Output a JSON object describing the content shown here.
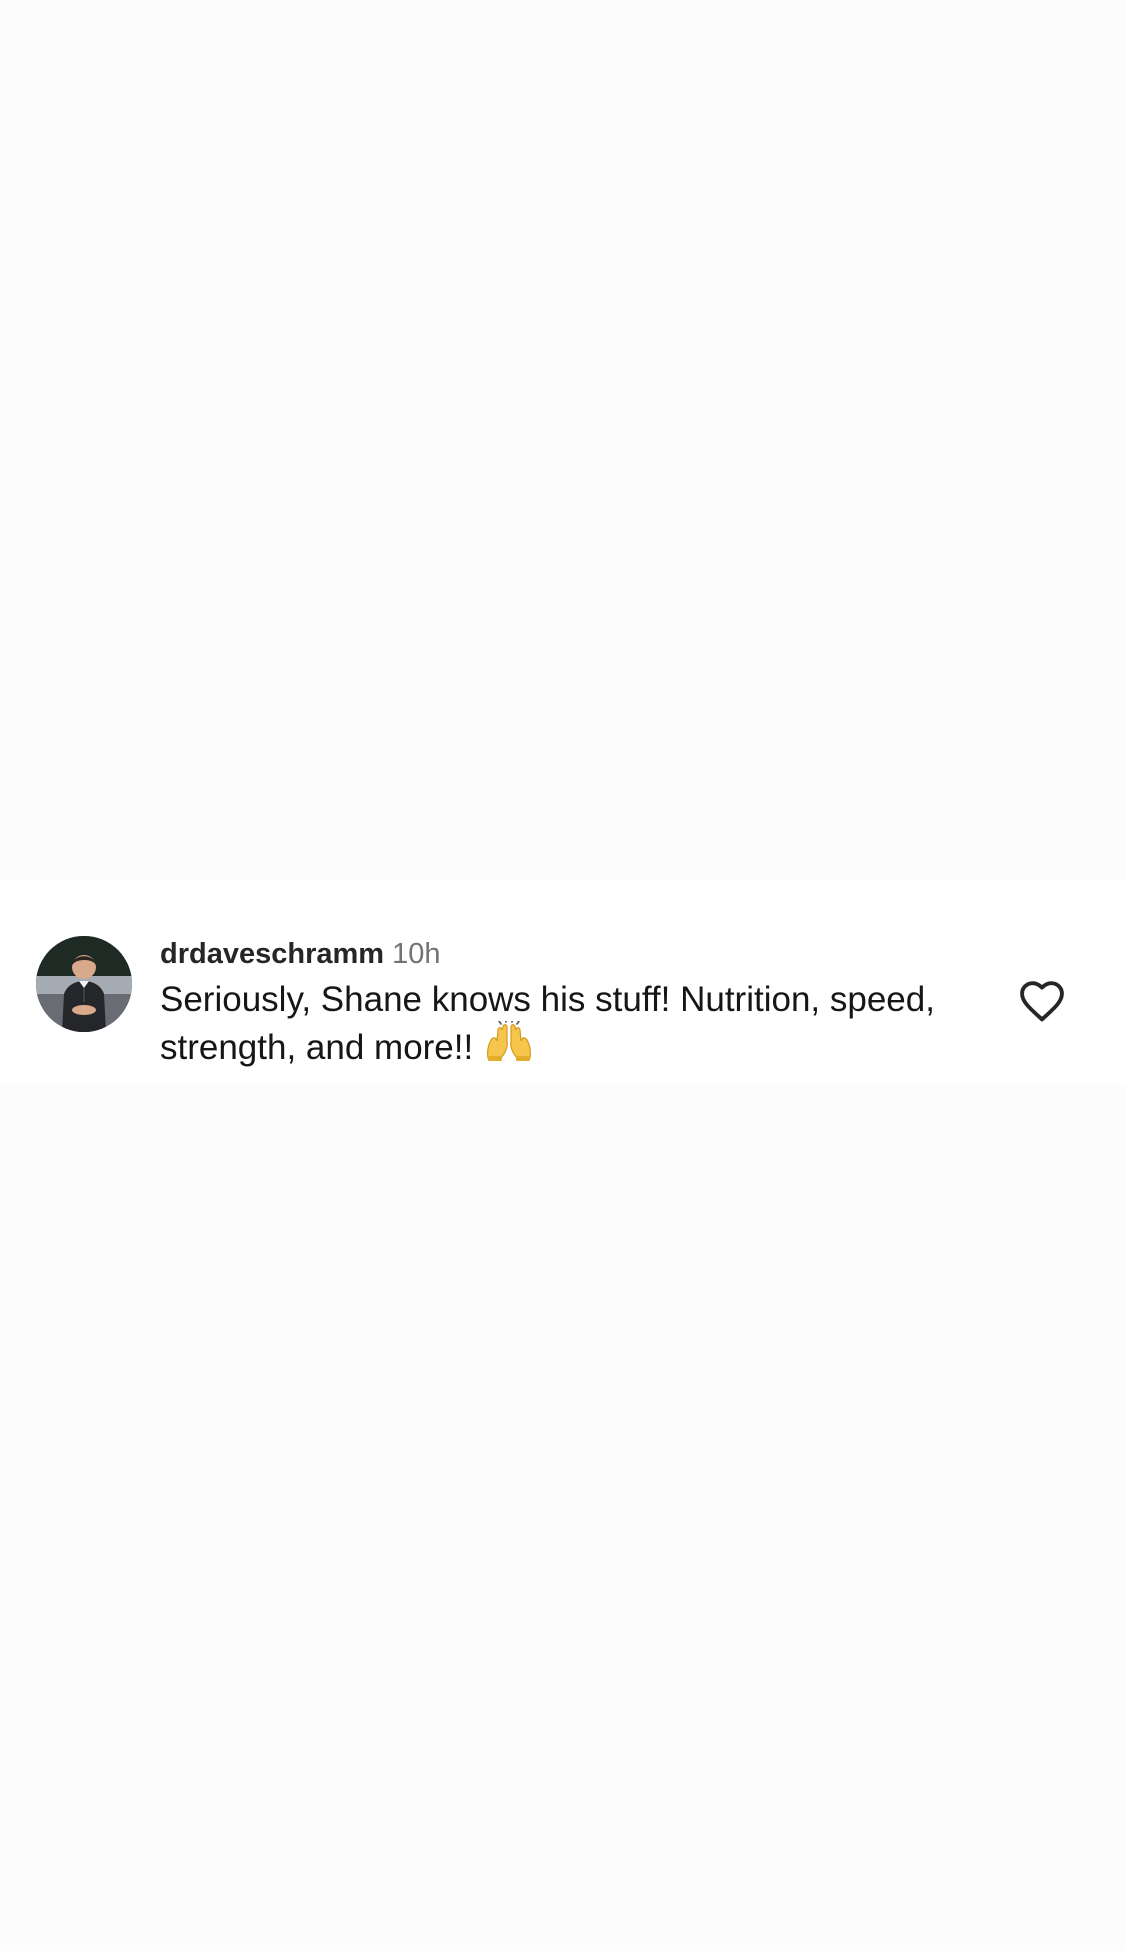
{
  "comment": {
    "username": "drdaveschramm",
    "timestamp": "10h",
    "text": "Seriously, Shane knows his stuff! Nutrition, speed, strength, and more!!",
    "emoji_icon": "raising-hands-emoji",
    "like_icon": "heart-outline-icon",
    "avatar_icon": "profile-photo"
  },
  "colors": {
    "background": "#fcfcfc",
    "card_background": "#ffffff",
    "username": "#262626",
    "timestamp": "#737373",
    "text": "#161616"
  }
}
